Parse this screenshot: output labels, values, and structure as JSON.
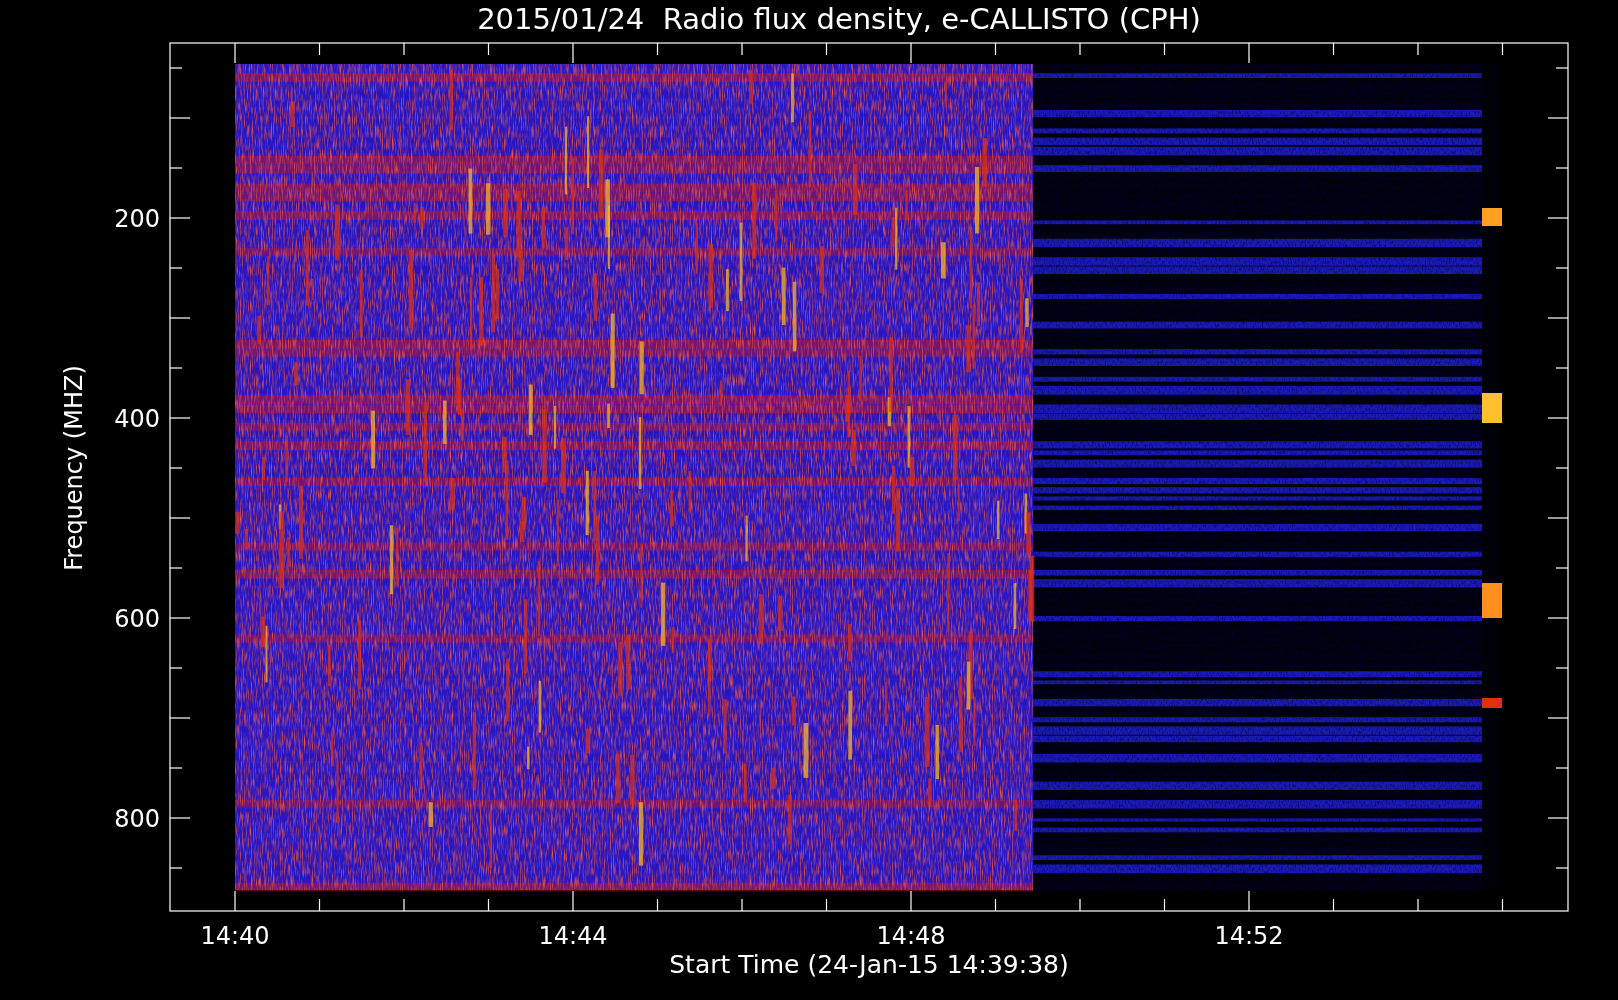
{
  "title": "2015/01/24  Radio flux density, e-CALLISTO (CPH)",
  "y_axis": {
    "label": "Frequency (MHZ)",
    "ticks": [
      "200",
      "400",
      "600",
      "800"
    ]
  },
  "x_axis": {
    "label": "Start Time (24-Jan-15 14:39:38)",
    "ticks": [
      "14:40",
      "14:44",
      "14:48",
      "14:52"
    ]
  }
}
